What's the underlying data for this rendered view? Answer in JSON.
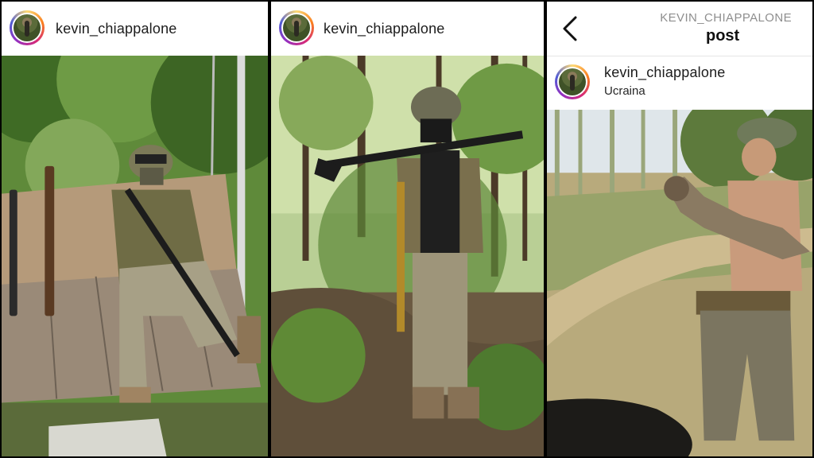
{
  "panels": [
    {
      "username": "kevin_chiappalone"
    },
    {
      "username": "kevin_chiappalone"
    },
    {
      "header_owner": "KEVIN_CHIAPPALONE",
      "header_title": "post",
      "username": "kevin_chiappalone",
      "location": "Ucraina"
    }
  ],
  "icons": {
    "back": "chevron-left-icon",
    "avatar": "profile-avatar"
  },
  "colors": {
    "story_ring": [
      "#feda75",
      "#fa7e1e",
      "#d62976",
      "#962fbf",
      "#4f5bd5"
    ],
    "foliage": "#4f7a2c"
  }
}
